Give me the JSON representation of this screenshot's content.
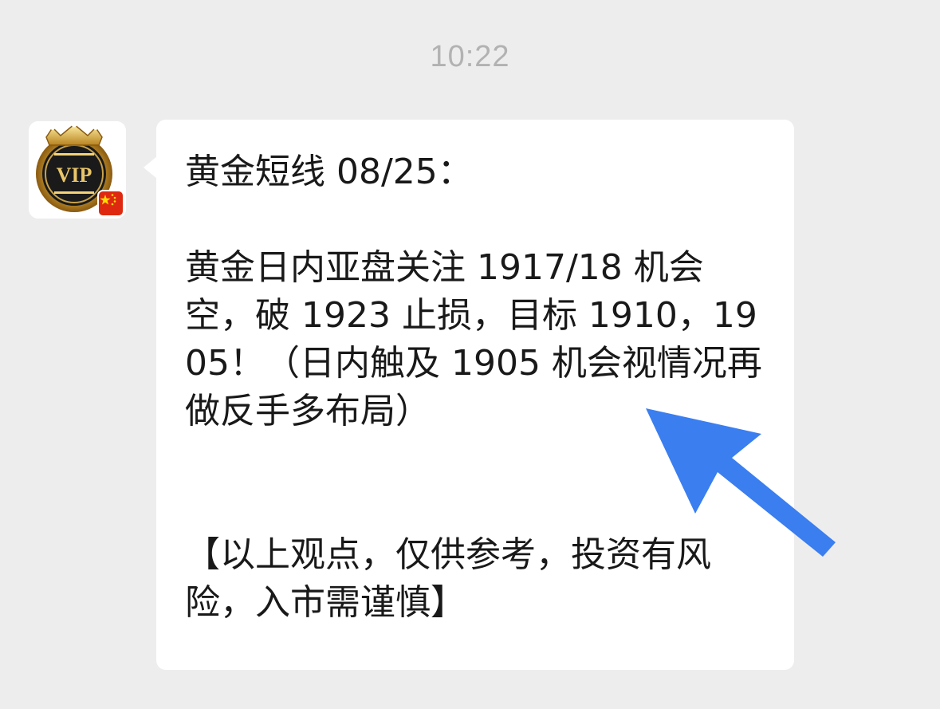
{
  "chat": {
    "timestamp": "10:22",
    "avatar": {
      "badge_text": "VIP",
      "flag": "china-flag"
    },
    "message": {
      "text": "黄金短线 08/25：\n\n黄金日内亚盘关注 1917/18 机会空，破 1923 止损，目标 1910，1905！（日内触及 1905 机会视情况再做反手多布局）\n\n\n【以上观点，仅供参考，投资有风险，入市需谨慎】"
    }
  },
  "annotation": {
    "arrow_color": "#3a7ef0",
    "arrow_icon": "arrow-up-left-icon"
  },
  "colors": {
    "background": "#ededed",
    "bubble": "#ffffff",
    "timestamp": "#b2b2b2",
    "text": "#191919"
  }
}
